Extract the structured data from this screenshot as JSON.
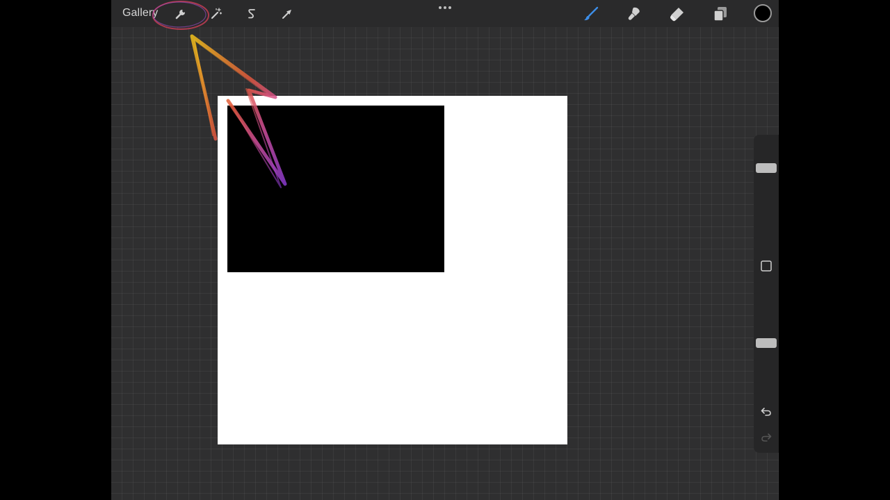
{
  "toolbar": {
    "gallery_label": "Gallery",
    "left_tools": [
      {
        "name": "actions",
        "icon": "wrench-icon"
      },
      {
        "name": "adjustments",
        "icon": "magic-wand-icon"
      },
      {
        "name": "selection",
        "icon": "selection-s-icon"
      },
      {
        "name": "transform",
        "icon": "arrow-cursor-icon"
      }
    ],
    "more_icon": "more-dots-icon",
    "right_tools": [
      {
        "name": "brush",
        "icon": "brush-icon",
        "active": true
      },
      {
        "name": "smudge",
        "icon": "smudge-icon"
      },
      {
        "name": "eraser",
        "icon": "eraser-icon"
      },
      {
        "name": "layers",
        "icon": "layers-icon"
      }
    ],
    "current_color": "#000000"
  },
  "sidebar": {
    "brush_size_level": 0.75,
    "opacity_level": 0.5,
    "modify_button_icon": "square-icon",
    "undo_icon": "undo-icon",
    "redo_icon": "redo-icon"
  },
  "colors": {
    "accent": "#3d8ee8",
    "background": "#2f2f30",
    "toolbar": "#2a2a2b",
    "canvas": "#ffffff"
  }
}
